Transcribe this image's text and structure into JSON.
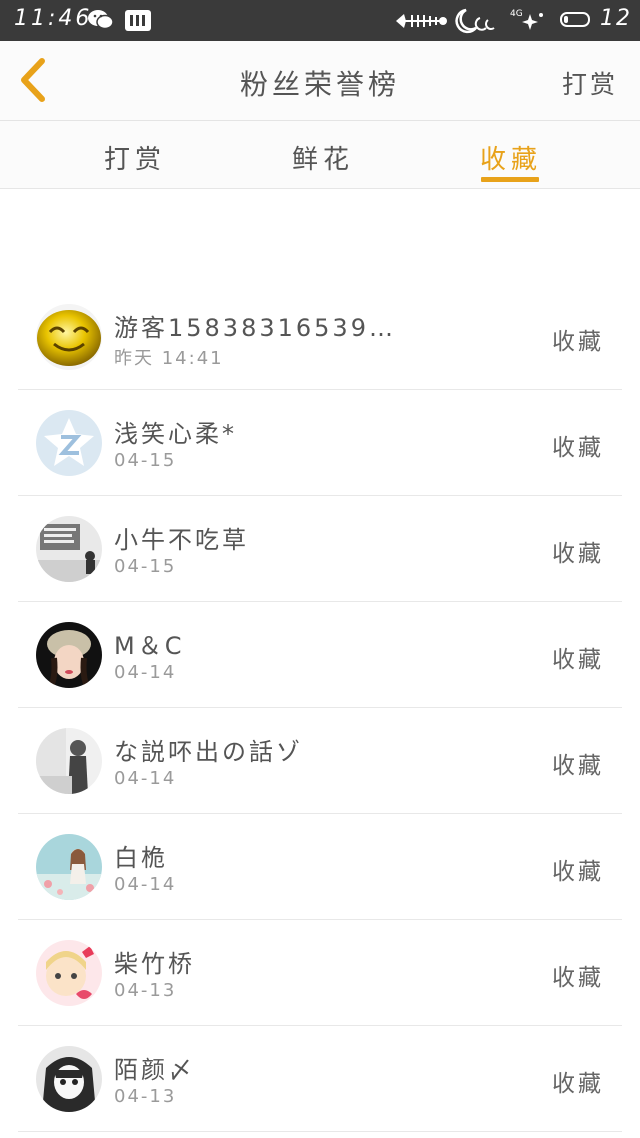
{
  "status_bar": {
    "time": "11:46",
    "battery": "12",
    "icons": [
      "wechat-icon",
      "sim-card-icon",
      "fishbone-icon",
      "moon-icon",
      "4g-signal-icon",
      "battery-icon"
    ]
  },
  "header": {
    "title": "粉丝荣誉榜",
    "right_link": "打赏",
    "back_icon": "chevron-left-icon"
  },
  "tabs": [
    {
      "label": "打赏"
    },
    {
      "label": "鲜花"
    },
    {
      "label": "收藏",
      "active": true
    }
  ],
  "fans": [
    {
      "name": "游客15838316539…",
      "date": "昨天 14:41",
      "action": "收藏"
    },
    {
      "name": "浅笑心柔*",
      "date": "04-15",
      "action": "收藏"
    },
    {
      "name": "小牛不吃草",
      "date": "04-15",
      "action": "收藏"
    },
    {
      "name": "M＆C",
      "date": "04-14",
      "action": "收藏"
    },
    {
      "name": "な説吥出の話ゾ",
      "date": "04-14",
      "action": "收藏"
    },
    {
      "name": "白桅",
      "date": "04-14",
      "action": "收藏"
    },
    {
      "name": "柴竹桥",
      "date": "04-13",
      "action": "收藏"
    },
    {
      "name": "陌颜〆",
      "date": "04-13",
      "action": "收藏"
    }
  ],
  "colors": {
    "accent": "#e8a21a",
    "status_bar": "#3a3a3a",
    "text": "#555555",
    "subtext": "#9a9a9a"
  }
}
